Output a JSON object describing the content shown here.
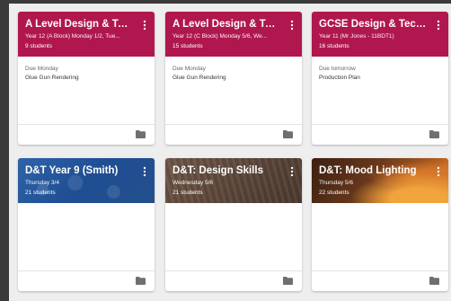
{
  "classes": [
    {
      "title": "A Level Design & Tec...",
      "section": "Year 12 (A Block) Monday 1/2, Tue...",
      "students": "9 students",
      "due_label": "Due Monday",
      "assignment": "Glue Gun Rendering",
      "theme": "maroon"
    },
    {
      "title": "A Level Design & Tec...",
      "section": "Year 12 (C Block) Monday 5/6, We...",
      "students": "15 students",
      "due_label": "Due Monday",
      "assignment": "Glue Gun Rendering",
      "theme": "maroon"
    },
    {
      "title": "GCSE Design & Techn...",
      "section": "Year 11 (Mr Jones - 11BDT1)",
      "students": "16 students",
      "due_label": "Due tomorrow",
      "assignment": "Production Plan",
      "theme": "maroon"
    },
    {
      "title": "D&T Year 9 (Smith)",
      "section": "Thursday 3/4",
      "students": "21 students",
      "due_label": "",
      "assignment": "",
      "theme": "blue"
    },
    {
      "title": "D&T: Design Skills",
      "section": "Wednesday 5/6",
      "students": "21 students",
      "due_label": "",
      "assignment": "",
      "theme": "brown"
    },
    {
      "title": "D&T: Mood Lighting",
      "section": "Thursday 5/6",
      "students": "22 students",
      "due_label": "",
      "assignment": "",
      "theme": "fire"
    }
  ],
  "colors": {
    "maroon": "#b0174f",
    "blue": "#2a5aa0",
    "brown": "#5f4a3c",
    "fire": "#8a4a20"
  },
  "icons": {
    "more": "more-vert-icon",
    "folder": "folder-icon"
  }
}
